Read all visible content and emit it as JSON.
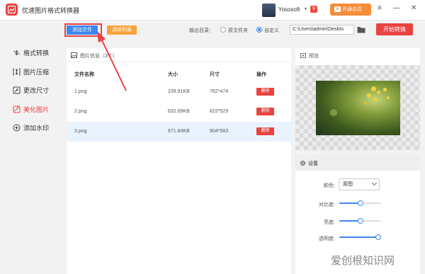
{
  "app": {
    "title": "优速图片格式转换器"
  },
  "account": {
    "username": "Yososoft",
    "dropdown": "▾",
    "vip_badge": "V",
    "member_button": "开通会员",
    "crown": "♛"
  },
  "window_controls": {
    "menu": "≡",
    "minimize": "—",
    "maximize": "☐",
    "close": "✕"
  },
  "sidebar": {
    "items": [
      {
        "label": "格式转换",
        "icon": "format-convert-icon"
      },
      {
        "label": "图片压缩",
        "icon": "compress-icon"
      },
      {
        "label": "更改尺寸",
        "icon": "resize-icon"
      },
      {
        "label": "美化图片",
        "icon": "beautify-icon",
        "active": true
      },
      {
        "label": "添加水印",
        "icon": "watermark-icon"
      }
    ]
  },
  "toolbar": {
    "add_file": "添加文件",
    "clear_list": "清除列表",
    "output_label": "输出目录：",
    "option_original": "原文件夹",
    "option_custom": "自定义",
    "path_value": "C:\\Users\\admin\\Deskto",
    "start_button": "开始转换"
  },
  "file_panel": {
    "title": "图片信息（3个）",
    "columns": [
      "文件名称",
      "大小",
      "尺寸",
      "操作"
    ],
    "rows": [
      {
        "name": "1.png",
        "size": "239.91KB",
        "dimensions": "762*474",
        "action": "删除"
      },
      {
        "name": "2.png",
        "size": "632.69KB",
        "dimensions": "815*529",
        "action": "删除"
      },
      {
        "name": "3.png",
        "size": "671.84KB",
        "dimensions": "904*583",
        "action": "删除",
        "selected": true
      }
    ]
  },
  "preview": {
    "title": "预览"
  },
  "settings": {
    "title": "设置",
    "color_label": "颜色:",
    "color_value": "原图",
    "contrast_label": "对比度:",
    "contrast_level": 0.5,
    "brightness_label": "亮度:",
    "brightness_level": 0.5,
    "opacity_label": "透明度:",
    "opacity_level": 1.0
  },
  "watermark": {
    "text": "爱创根知识网"
  },
  "colors": {
    "accent_red": "#e8433f",
    "accent_blue": "#3d87f1",
    "accent_orange": "#f7a23b"
  }
}
